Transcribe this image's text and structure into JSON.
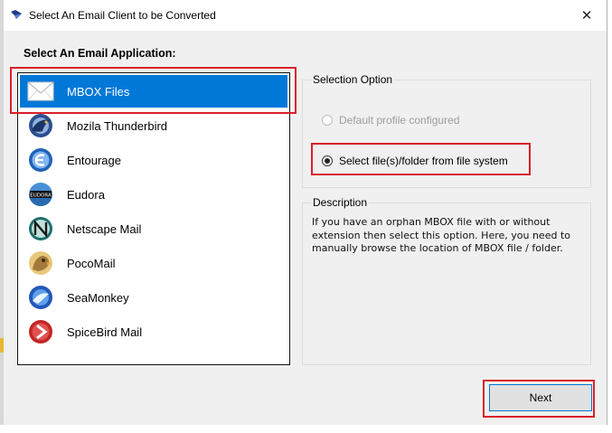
{
  "window": {
    "title": "Select An Email Client to be Converted",
    "close_glyph": "✕"
  },
  "heading": "Select An Email Application:",
  "clients": [
    {
      "label": "MBOX Files",
      "icon": "envelope-icon",
      "selected": true
    },
    {
      "label": "Mozila Thunderbird",
      "icon": "thunderbird-icon",
      "selected": false
    },
    {
      "label": "Entourage",
      "icon": "entourage-icon",
      "selected": false
    },
    {
      "label": "Eudora",
      "icon": "eudora-icon",
      "selected": false
    },
    {
      "label": "Netscape Mail",
      "icon": "netscape-icon",
      "selected": false
    },
    {
      "label": "PocoMail",
      "icon": "pocomail-icon",
      "selected": false
    },
    {
      "label": "SeaMonkey",
      "icon": "seamonkey-icon",
      "selected": false
    },
    {
      "label": "SpiceBird Mail",
      "icon": "spicebird-icon",
      "selected": false
    }
  ],
  "selection_option": {
    "label": "Selection Option",
    "options": [
      {
        "label": "Default profile configured",
        "enabled": false,
        "checked": false
      },
      {
        "label": "Select file(s)/folder from file system",
        "enabled": true,
        "checked": true
      }
    ]
  },
  "description": {
    "label": "Description",
    "text": "If you have an orphan MBOX file with or without extension then select this option. Here, you need to manually browse the location of MBOX file / folder."
  },
  "buttons": {
    "next_label": "Next"
  },
  "colors": {
    "selection_blue": "#0078d7",
    "highlight_red": "#d9202a",
    "dialog_bg": "#f0f0f0"
  }
}
